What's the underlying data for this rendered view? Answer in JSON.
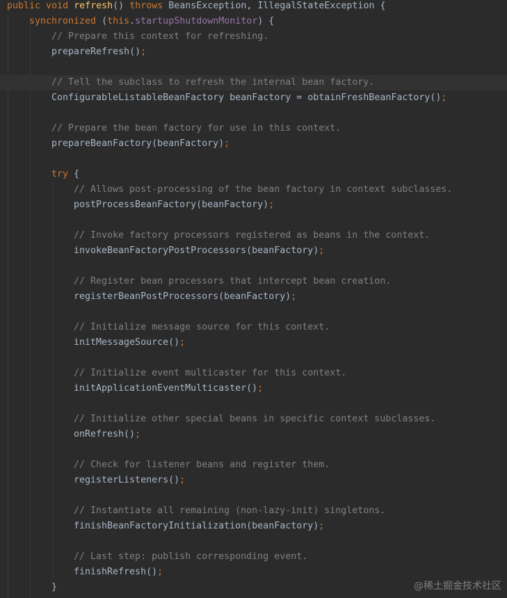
{
  "code": {
    "line1": {
      "kw_public": "public",
      "kw_void": "void",
      "method_name": "refresh",
      "parens": "()",
      "kw_throws": "throws",
      "exceptions": "BeansException, IllegalStateException {"
    },
    "line2": {
      "kw_synchronized": "synchronized",
      "open": "(",
      "kw_this": "this",
      "dot": ".",
      "field": "startupShutdownMonitor",
      "close": ") {"
    },
    "comment_prepare_refresh": "// Prepare this context for refreshing.",
    "call_prepare_refresh": "prepareRefresh()",
    "comment_tell_subclass": "// Tell the subclass to refresh the internal bean factory.",
    "decl_bean_factory": "ConfigurableListableBeanFactory beanFactory = obtainFreshBeanFactory()",
    "comment_prepare_bean_factory": "// Prepare the bean factory for use in this context.",
    "call_prepare_bean_factory": "prepareBeanFactory(beanFactory)",
    "kw_try": "try",
    "try_brace": " {",
    "comment_post_process": "// Allows post-processing of the bean factory in context subclasses.",
    "call_post_process": "postProcessBeanFactory(beanFactory)",
    "comment_invoke_processors": "// Invoke factory processors registered as beans in the context.",
    "call_invoke_processors": "invokeBeanFactoryPostProcessors(beanFactory)",
    "comment_register_processors": "// Register bean processors that intercept bean creation.",
    "call_register_processors": "registerBeanPostProcessors(beanFactory)",
    "comment_init_message": "// Initialize message source for this context.",
    "call_init_message": "initMessageSource()",
    "comment_init_multicaster": "// Initialize event multicaster for this context.",
    "call_init_multicaster": "initApplicationEventMulticaster()",
    "comment_special_beans": "// Initialize other special beans in specific context subclasses.",
    "call_on_refresh": "onRefresh()",
    "comment_listeners": "// Check for listener beans and register them.",
    "call_register_listeners": "registerListeners()",
    "comment_singletons": "// Instantiate all remaining (non-lazy-init) singletons.",
    "call_finish_init": "finishBeanFactoryInitialization(beanFactory)",
    "comment_last_step": "// Last step: publish corresponding event.",
    "call_finish_refresh": "finishRefresh()",
    "semicolon": ";",
    "closing_brace": "}"
  },
  "watermark": "@稀土掘金技术社区",
  "colors": {
    "background": "#2b2b2b",
    "keyword": "#cc7832",
    "method_declaration": "#ffc66d",
    "comment": "#808080",
    "field": "#9876aa",
    "identifier": "#a9b7c6"
  }
}
